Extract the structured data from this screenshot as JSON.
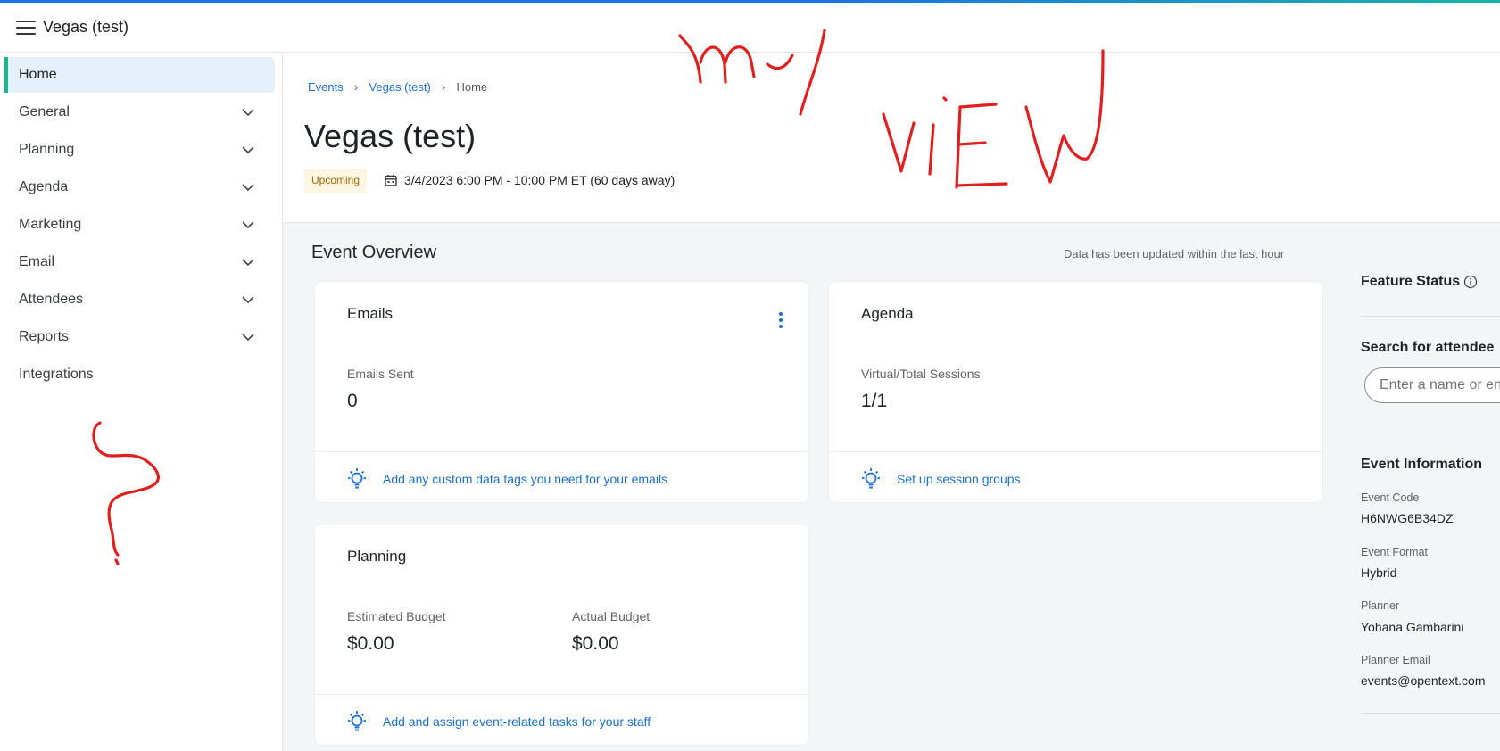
{
  "app": {
    "title": "Vegas (test)"
  },
  "sidebar": {
    "items": [
      {
        "label": "Home",
        "active": true,
        "expandable": false
      },
      {
        "label": "General",
        "expandable": true
      },
      {
        "label": "Planning",
        "expandable": true
      },
      {
        "label": "Agenda",
        "expandable": true
      },
      {
        "label": "Marketing",
        "expandable": true
      },
      {
        "label": "Email",
        "expandable": true
      },
      {
        "label": "Attendees",
        "expandable": true
      },
      {
        "label": "Reports",
        "expandable": true
      },
      {
        "label": "Integrations",
        "expandable": false
      }
    ]
  },
  "breadcrumb": {
    "events": "Events",
    "event": "Vegas (test)",
    "current": "Home"
  },
  "header": {
    "title": "Vegas (test)",
    "status_badge": "Upcoming",
    "date_text": "3/4/2023 6:00 PM - 10:00 PM ET (60 days away)"
  },
  "overview": {
    "title": "Event Overview",
    "updated_text": "Data has been updated within the last hour",
    "emails": {
      "title": "Emails",
      "label": "Emails Sent",
      "value": "0",
      "tip": "Add any custom data tags you need for your emails"
    },
    "agenda": {
      "title": "Agenda",
      "label": "Virtual/Total Sessions",
      "value": "1/1",
      "tip": "Set up session groups"
    },
    "planning": {
      "title": "Planning",
      "estimated_label": "Estimated Budget",
      "estimated_value": "$0.00",
      "actual_label": "Actual Budget",
      "actual_value": "$0.00",
      "tip": "Add and assign event-related tasks for your staff"
    }
  },
  "right_panel": {
    "feature_status": "Feature Status",
    "search_heading": "Search for attendee",
    "search_placeholder": "Enter a name or en",
    "event_info_heading": "Event Information",
    "event_code_label": "Event Code",
    "event_code": "H6NWG6B34DZ",
    "event_format_label": "Event Format",
    "event_format": "Hybrid",
    "planner_label": "Planner",
    "planner": "Yohana Gambarini",
    "planner_email_label": "Planner Email",
    "planner_email": "events@opentext.com"
  },
  "colors": {
    "accent": "#1a6fd1",
    "active_indicator": "#16b98a",
    "annotation": "#e0201f",
    "badge_bg": "#fdf6e3"
  },
  "icons": [
    "hamburger-icon",
    "chevron-down-icon",
    "calendar-icon",
    "lightbulb-icon",
    "kebab-menu-icon",
    "info-icon"
  ]
}
